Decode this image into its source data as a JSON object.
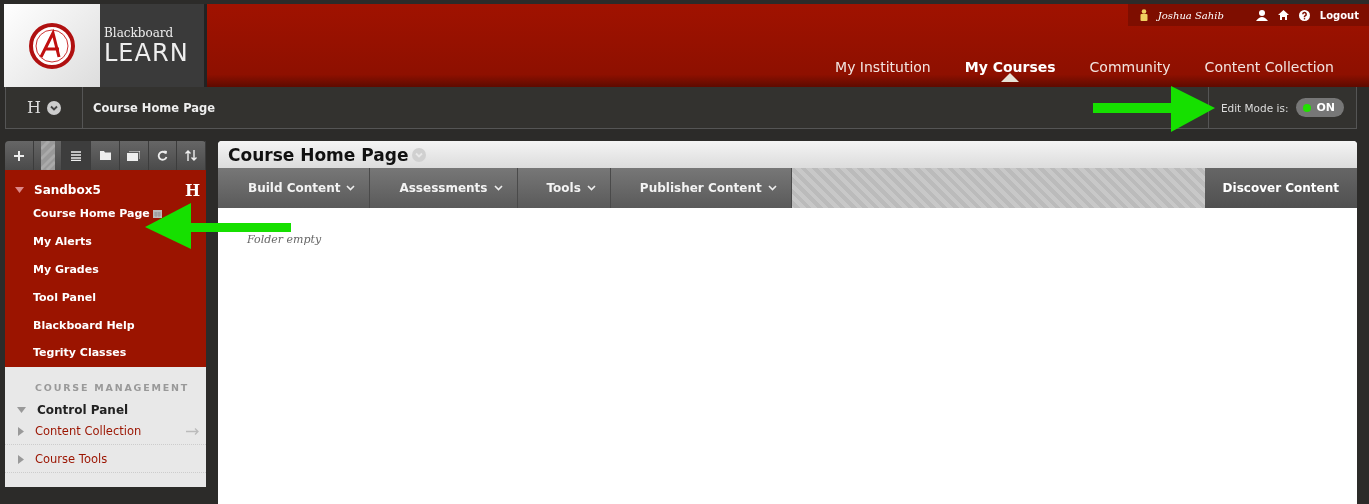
{
  "logo": {
    "line1": "Blackboard",
    "line2": "LEARN"
  },
  "user_bar": {
    "name": "Joshua Sahib",
    "logout": "Logout"
  },
  "nav_tabs": [
    {
      "label": "My Institution",
      "selected": false
    },
    {
      "label": "My Courses",
      "selected": true
    },
    {
      "label": "Community",
      "selected": false
    },
    {
      "label": "Content Collection",
      "selected": false
    }
  ],
  "breadcrumb": {
    "mark": "H",
    "page": "Course Home Page"
  },
  "edit_mode": {
    "label": "Edit Mode is:",
    "state": "ON",
    "on": true
  },
  "sidebar_tools": [
    {
      "kind": "add",
      "selected": false
    },
    {
      "kind": "stripe",
      "selected": false
    },
    {
      "kind": "list",
      "selected": true
    },
    {
      "kind": "folder",
      "selected": false
    },
    {
      "kind": "window",
      "selected": false
    },
    {
      "kind": "refresh",
      "selected": false
    },
    {
      "kind": "sort",
      "selected": false
    }
  ],
  "course_menu": {
    "title": "Sandbox5",
    "mark": "H",
    "expanded": true,
    "items": [
      {
        "label": "Course Home Page",
        "kind": "page"
      },
      {
        "label": "My Alerts",
        "kind": "link"
      },
      {
        "label": "My Grades",
        "kind": "link"
      },
      {
        "label": "Tool Panel",
        "kind": "link"
      },
      {
        "label": "Blackboard Help",
        "kind": "link"
      },
      {
        "label": "Tegrity Classes",
        "kind": "link"
      }
    ]
  },
  "course_management": {
    "heading": "COURSE MANAGEMENT",
    "panel": {
      "label": "Control Panel",
      "expanded": true,
      "children": [
        {
          "label": "Content Collection",
          "expanded": false,
          "link_out": true
        },
        {
          "label": "Course Tools",
          "expanded": false,
          "link_out": false
        }
      ]
    }
  },
  "content": {
    "title": "Course Home Page",
    "menu": [
      "Build Content",
      "Assessments",
      "Tools",
      "Publisher Content"
    ],
    "discover": "Discover Content",
    "empty_text": "Folder empty"
  }
}
